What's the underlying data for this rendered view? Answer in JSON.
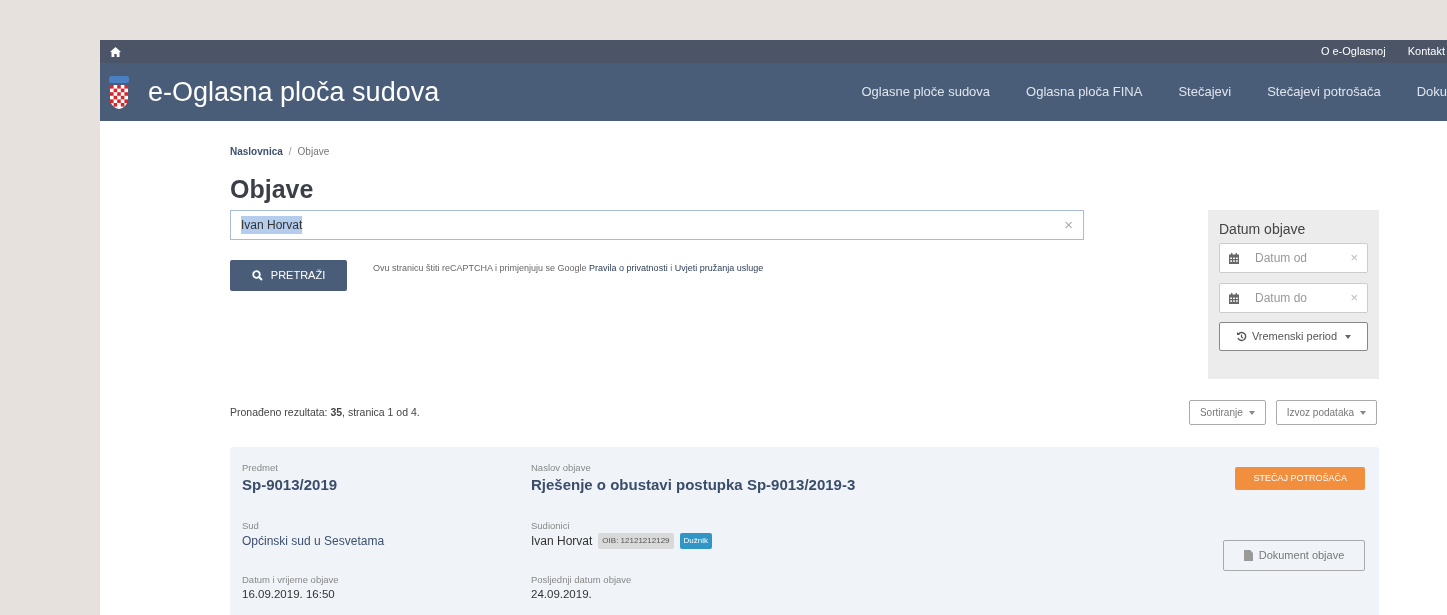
{
  "top_bar": {
    "links": [
      "O e-Oglasnoj",
      "Kontakt"
    ]
  },
  "header": {
    "title": "e-Oglasna ploča sudova",
    "nav": [
      "Oglasne ploče sudova",
      "Oglasna ploča FINA",
      "Stečajevi",
      "Stečajevi potrošača",
      "Doku"
    ]
  },
  "breadcrumb": [
    {
      "label": "Naslovnica",
      "selected": false
    },
    {
      "label": "Objave",
      "selected": true
    }
  ],
  "breadcrumb_separator": "/",
  "page_title": "Objave",
  "search": {
    "value": "Ivan Horvat",
    "clear": "×",
    "button": "PRETRAŽI",
    "notice": "Ovu stranicu štiti reCAPTCHA i primjenjuju se Google **Pravila o privatnosti** i **Uvjeti pružanja usluge**"
  },
  "date_filter": {
    "title": "Datum objave",
    "fields": [
      {
        "placeholder": "Datum od",
        "clear": "×"
      },
      {
        "placeholder": "Datum do",
        "clear": "×"
      }
    ],
    "period_button": "Vremenski period"
  },
  "results": {
    "summary": "Pronađeno rezultata: **35**, stranica 1 od 4.",
    "buttons": [
      "Sortiranje",
      "Izvoz podataka"
    ]
  },
  "cards": [
    {
      "fields": [
        {
          "label": "Predmet",
          "value": "Sp-9013/2019",
          "kind": "heading"
        },
        {
          "label": "Naslov objave",
          "value": "Rješenje o obustavi postupka Sp-9013/2019-3",
          "kind": "heading"
        },
        {
          "label": "Sud",
          "value": "Općinski sud u Sesvetama",
          "kind": "court"
        },
        {
          "label": "Sudionici",
          "value": "Ivan Horvat",
          "kind": "participant",
          "oib": "OIB: 12121212129",
          "role": "Dužnik"
        },
        {
          "label": "Datum i vrijeme objave",
          "value": "16.09.2019. 16:50",
          "kind": "plain"
        },
        {
          "label": "Posljednji datum objave",
          "value": "24.09.2019.",
          "kind": "plain"
        }
      ],
      "tag": "STEČAJ POTROŠAČA",
      "document_button": "Dokument objave"
    }
  ]
}
